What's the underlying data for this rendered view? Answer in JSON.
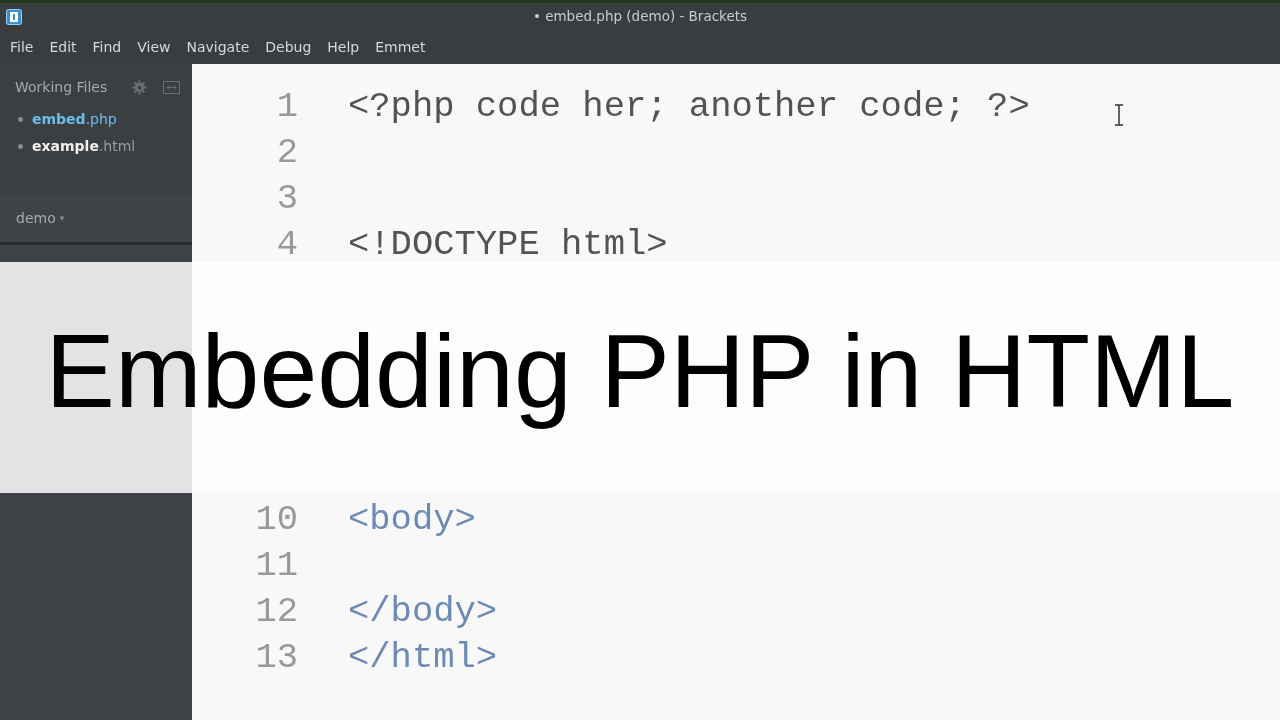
{
  "window": {
    "title": "• embed.php (demo) - Brackets"
  },
  "menu": [
    "File",
    "Edit",
    "Find",
    "View",
    "Navigate",
    "Debug",
    "Help",
    "Emmet"
  ],
  "sidebar": {
    "working_files": {
      "title": "Working Files",
      "files": [
        {
          "name": "embed",
          "ext": ".php",
          "selected": true
        },
        {
          "name": "example",
          "ext": ".html",
          "selected": false
        }
      ]
    },
    "project": {
      "name": "demo",
      "caret": "▾"
    }
  },
  "editor": {
    "lines": [
      {
        "number": "1",
        "tokens": [
          {
            "kind": "php",
            "text": "<?php code her; another code; ?>"
          }
        ]
      },
      {
        "number": "2"
      },
      {
        "number": "3"
      },
      {
        "number": "4",
        "tokens": [
          {
            "kind": "doctype",
            "text": "<!DOCTYPE html>"
          }
        ]
      },
      {
        "number": "10",
        "tokens": [
          {
            "kind": "tag",
            "text": "<body>"
          }
        ]
      },
      {
        "number": "11"
      },
      {
        "number": "12",
        "tokens": [
          {
            "kind": "tag",
            "text": "</body>"
          }
        ]
      },
      {
        "number": "13",
        "tokens": [
          {
            "kind": "tag",
            "text": "</html>"
          }
        ]
      }
    ]
  },
  "overlay_title": "Embedding PHP in HTML"
}
